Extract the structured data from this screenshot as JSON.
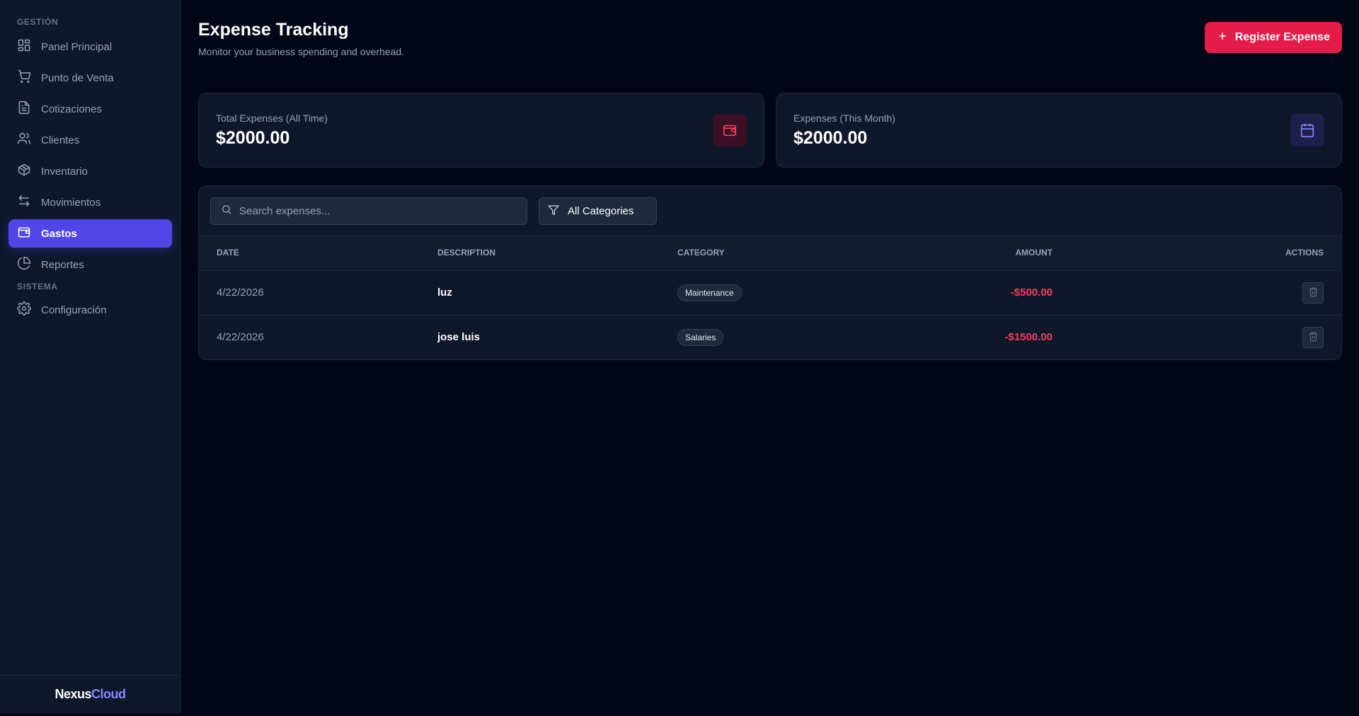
{
  "sidebar": {
    "section_management": "GESTIÓN",
    "items": [
      {
        "label": "Panel Principal",
        "icon": "dashboard-icon"
      },
      {
        "label": "Punto de Venta",
        "icon": "cart-icon"
      },
      {
        "label": "Cotizaciones",
        "icon": "document-icon"
      },
      {
        "label": "Clientes",
        "icon": "users-icon"
      },
      {
        "label": "Inventario",
        "icon": "box-icon"
      },
      {
        "label": "Movimientos",
        "icon": "arrows-icon"
      },
      {
        "label": "Gastos",
        "icon": "wallet-icon",
        "active": true
      },
      {
        "label": "Reportes",
        "icon": "pie-chart-icon"
      }
    ],
    "section_system": "SISTEMA",
    "system_items": [
      {
        "label": "Configuración",
        "icon": "gear-icon"
      }
    ],
    "brand_part1": "Nexus",
    "brand_part2": "Cloud"
  },
  "header": {
    "title": "Expense Tracking",
    "subtitle": "Monitor your business spending and overhead.",
    "register_button": "Register Expense"
  },
  "stats": [
    {
      "label": "Total Expenses (All Time)",
      "value": "$2000.00",
      "icon": "wallet-icon",
      "color": "#f43f5e"
    },
    {
      "label": "Expenses (This Month)",
      "value": "$2000.00",
      "icon": "calendar-icon",
      "color": "#818cf8"
    }
  ],
  "filters": {
    "search_placeholder": "Search expenses...",
    "category_value": "All Categories"
  },
  "table": {
    "headers": {
      "date": "DATE",
      "description": "DESCRIPTION",
      "category": "CATEGORY",
      "amount": "AMOUNT",
      "actions": "ACTIONS"
    },
    "rows": [
      {
        "date": "4/22/2026",
        "description": "luz",
        "category": "Maintenance",
        "amount": "-$500.00"
      },
      {
        "date": "4/22/2026",
        "description": "jose luis",
        "category": "Salaries",
        "amount": "-$1500.00"
      }
    ]
  },
  "colors": {
    "accent": "#4f46e5",
    "danger": "#e11d48",
    "background": "#020617",
    "panel": "#0f172a"
  }
}
